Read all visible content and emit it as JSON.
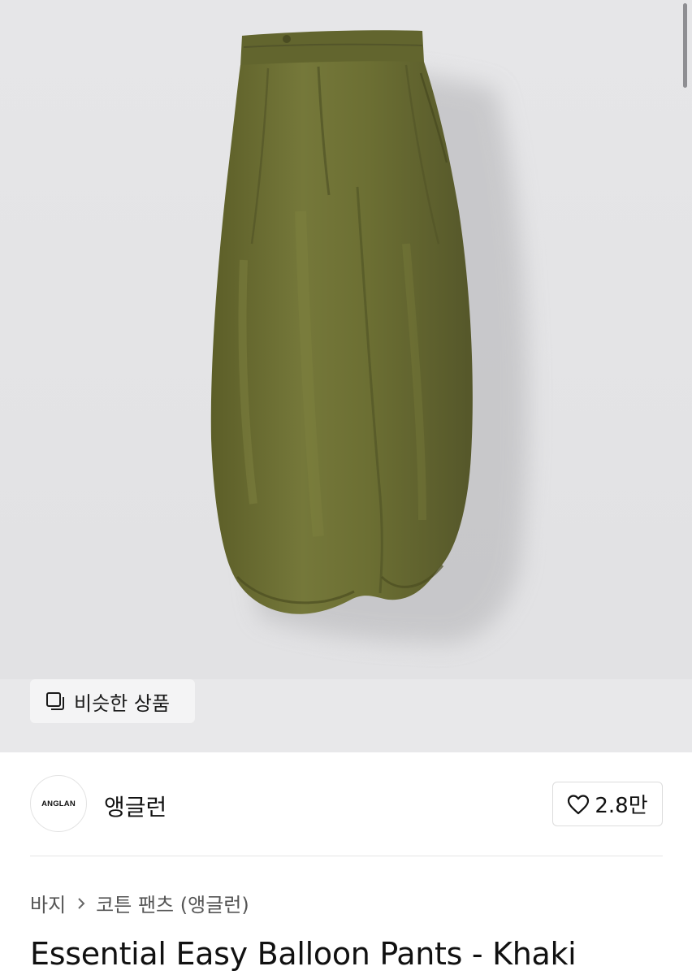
{
  "product_image": {
    "alt": "Essential Easy Balloon Pants - Khaki",
    "colors": {
      "background": "#e4e4e6",
      "fabric": "#6e7034",
      "fabric_dark": "#545626",
      "fabric_light": "#83853f"
    }
  },
  "similar_button": {
    "label": "비슷한 상품",
    "icon": "similar-items-icon"
  },
  "brand": {
    "logo_text": "ANGLAN",
    "name": "앵글런"
  },
  "like": {
    "icon": "heart-icon",
    "count": "2.8만"
  },
  "breadcrumb": {
    "items": [
      "바지",
      "코튼 팬츠 (앵글런)"
    ]
  },
  "product": {
    "title": "Essential Easy Balloon Pants - Khaki"
  }
}
